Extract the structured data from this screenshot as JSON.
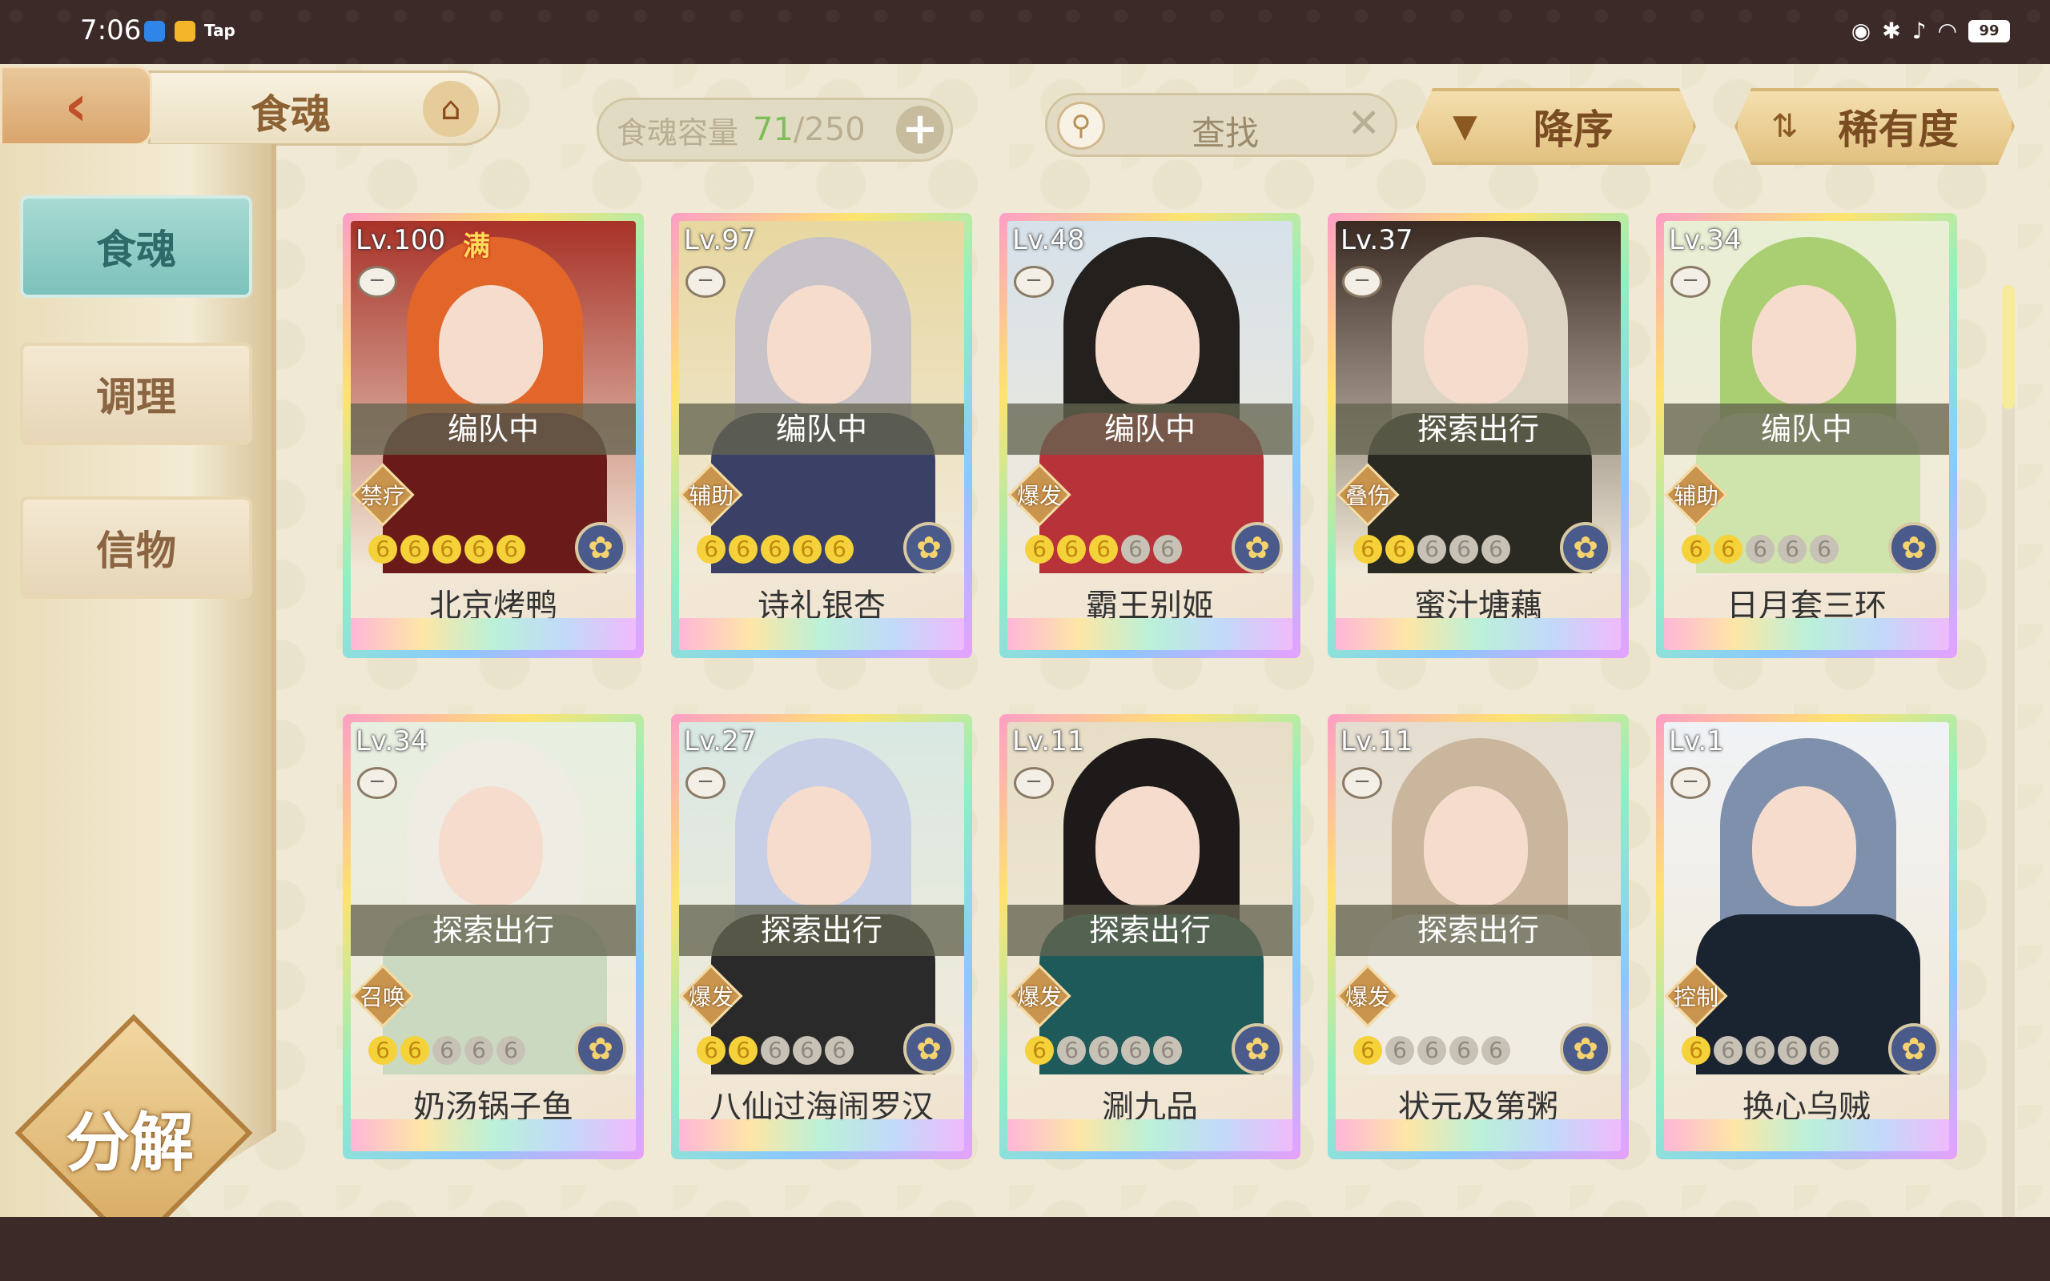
{
  "status_bar": {
    "time": "7:06",
    "tap_label": "Tap",
    "battery": "99"
  },
  "header": {
    "title": "食魂",
    "capacity_label": "食魂容量",
    "capacity_current": "71",
    "capacity_max": "/250",
    "capacity_add": "+",
    "search_placeholder": "查找",
    "search_clear": "✕",
    "sort_order_label": "降序",
    "sort_field_label": "稀有度"
  },
  "sidebar": {
    "items": [
      {
        "label": "食魂",
        "active": true
      },
      {
        "label": "调理",
        "active": false
      },
      {
        "label": "信物",
        "active": false
      }
    ],
    "decompose_label": "分解"
  },
  "cards": [
    {
      "level": "Lv.100",
      "full": "满",
      "status": "编队中",
      "role": "禁疗",
      "name": "北京烤鸭",
      "stars_on": 5,
      "hair": "#e2662a",
      "robe": "#6a1a18",
      "bg": "#a83228"
    },
    {
      "level": "Lv.97",
      "full": "",
      "status": "编队中",
      "role": "辅助",
      "name": "诗礼银杏",
      "stars_on": 5,
      "hair": "#c8c3c9",
      "robe": "#3a4066",
      "bg": "#e7d7a0"
    },
    {
      "level": "Lv.48",
      "full": "",
      "status": "编队中",
      "role": "爆发",
      "name": "霸王别姬",
      "stars_on": 3,
      "hair": "#23201e",
      "robe": "#b8323a",
      "bg": "#d6e1ea"
    },
    {
      "level": "Lv.37",
      "full": "",
      "status": "探索出行",
      "role": "叠伤",
      "name": "蜜汁塘藕",
      "stars_on": 2,
      "hair": "#ddd4c4",
      "robe": "#2a2a22",
      "bg": "#3a2a22"
    },
    {
      "level": "Lv.34",
      "full": "",
      "status": "编队中",
      "role": "辅助",
      "name": "日月套三环",
      "stars_on": 2,
      "hair": "#a9cf72",
      "robe": "#cfe3ad",
      "bg": "#e8efd4"
    },
    {
      "level": "Lv.34",
      "full": "",
      "status": "探索出行",
      "role": "召唤",
      "name": "奶汤锅子鱼",
      "stars_on": 2,
      "hair": "#efece4",
      "robe": "#cbd9c0",
      "bg": "#e7efe1"
    },
    {
      "level": "Lv.27",
      "full": "",
      "status": "探索出行",
      "role": "爆发",
      "name": "八仙过海闹罗汉",
      "stars_on": 2,
      "hair": "#c6cfe6",
      "robe": "#2a2a2a",
      "bg": "#d9e8e3"
    },
    {
      "level": "Lv.11",
      "full": "",
      "status": "探索出行",
      "role": "爆发",
      "name": "涮九品",
      "stars_on": 1,
      "hair": "#1e1a1a",
      "robe": "#1f5a5a",
      "bg": "#e7ddc6"
    },
    {
      "level": "Lv.11",
      "full": "",
      "status": "探索出行",
      "role": "爆发",
      "name": "状元及第粥",
      "stars_on": 1,
      "hair": "#c9b69c",
      "robe": "#f1ece2",
      "bg": "#e4ddd0"
    },
    {
      "level": "Lv.1",
      "full": "",
      "status": "",
      "role": "控制",
      "name": "换心乌贼",
      "stars_on": 1,
      "hair": "#7f90ad",
      "robe": "#1a2430",
      "bg": "#f0f3f6"
    }
  ]
}
